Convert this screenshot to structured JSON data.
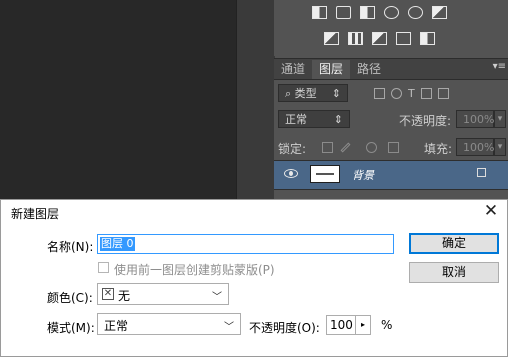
{
  "layers_panel": {
    "tabs": [
      "通道",
      "图层",
      "路径"
    ],
    "active_tab": "图层",
    "filter_kind": "类型",
    "blend_mode": "正常",
    "opacity_label": "不透明度:",
    "opacity_value": "100%",
    "lock_label": "锁定:",
    "fill_label": "填充:",
    "fill_value": "100%",
    "layer_name": "背景"
  },
  "dialog": {
    "title": "新建图层",
    "name_label": "名称(N):",
    "name_value": "图层 0",
    "clip_checkbox_label": "使用前一图层创建剪贴蒙版(P)",
    "color_label": "颜色(C):",
    "color_value": "无",
    "mode_label": "模式(M):",
    "mode_value": "正常",
    "opacity_label": "不透明度(O):",
    "opacity_value": "100",
    "percent": "%",
    "ok_button": "确定",
    "cancel_button": "取消"
  }
}
